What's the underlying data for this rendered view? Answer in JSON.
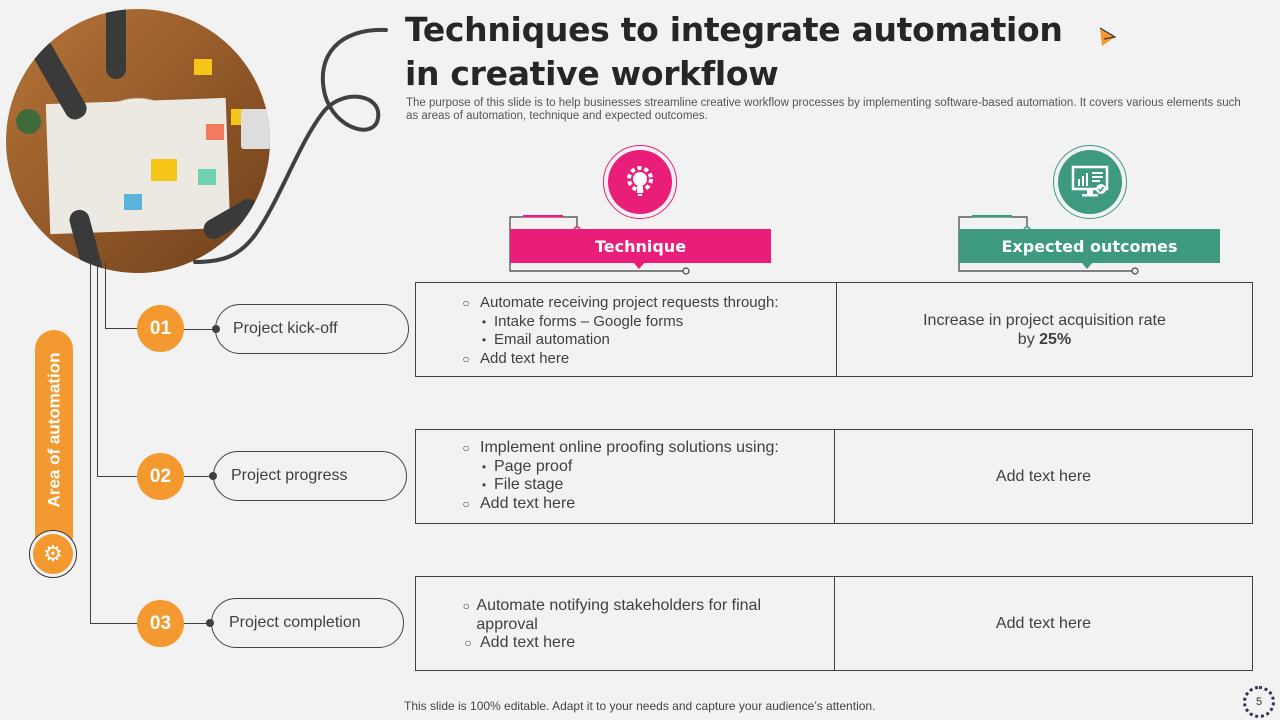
{
  "title": "Techniques to integrate automation in creative workflow",
  "subtitle": "The purpose of this slide is to help businesses streamline creative workflow processes by implementing software-based automation. It covers various elements such as areas of automation, technique and expected outcomes.",
  "colors": {
    "orange": "#f3992f",
    "pink": "#e91e78",
    "teal": "#3d9a80",
    "text": "#404040",
    "background": "#f2f2f2"
  },
  "sidebar": {
    "label": "Area of automation",
    "icon": "gear-automation-icon"
  },
  "headers": {
    "technique": {
      "label": "Technique",
      "icon": "lightbulb-gear-icon"
    },
    "outcomes": {
      "label": "Expected outcomes",
      "icon": "monitor-chart-icon"
    }
  },
  "rows": [
    {
      "number": "01",
      "area": "Project kick-off",
      "technique": [
        {
          "level": 1,
          "text": "Automate receiving project requests through:"
        },
        {
          "level": 2,
          "text": "Intake forms – Google forms"
        },
        {
          "level": 2,
          "text": "Email automation"
        },
        {
          "level": 1,
          "text": "Add text here"
        }
      ],
      "outcome_line1": "Increase in project acquisition rate",
      "outcome_prefix": "by ",
      "outcome_highlight": "25%"
    },
    {
      "number": "02",
      "area": "Project progress",
      "technique": [
        {
          "level": 1,
          "text": "Implement online proofing solutions using:"
        },
        {
          "level": 2,
          "text": "Page proof"
        },
        {
          "level": 2,
          "text": "File stage"
        },
        {
          "level": 1,
          "text": "Add text here"
        }
      ],
      "outcome": "Add text here"
    },
    {
      "number": "03",
      "area": "Project completion",
      "technique": [
        {
          "level": 1,
          "text": "Automate notifying stakeholders for final approval"
        },
        {
          "level": 1,
          "text": "Add text here"
        }
      ],
      "outcome": "Add text here"
    }
  ],
  "footer": "This slide is 100% editable. Adapt it to your needs and capture your audience’s attention.",
  "page_number": "5",
  "bullets": {
    "level1": "○",
    "level2": "•"
  }
}
